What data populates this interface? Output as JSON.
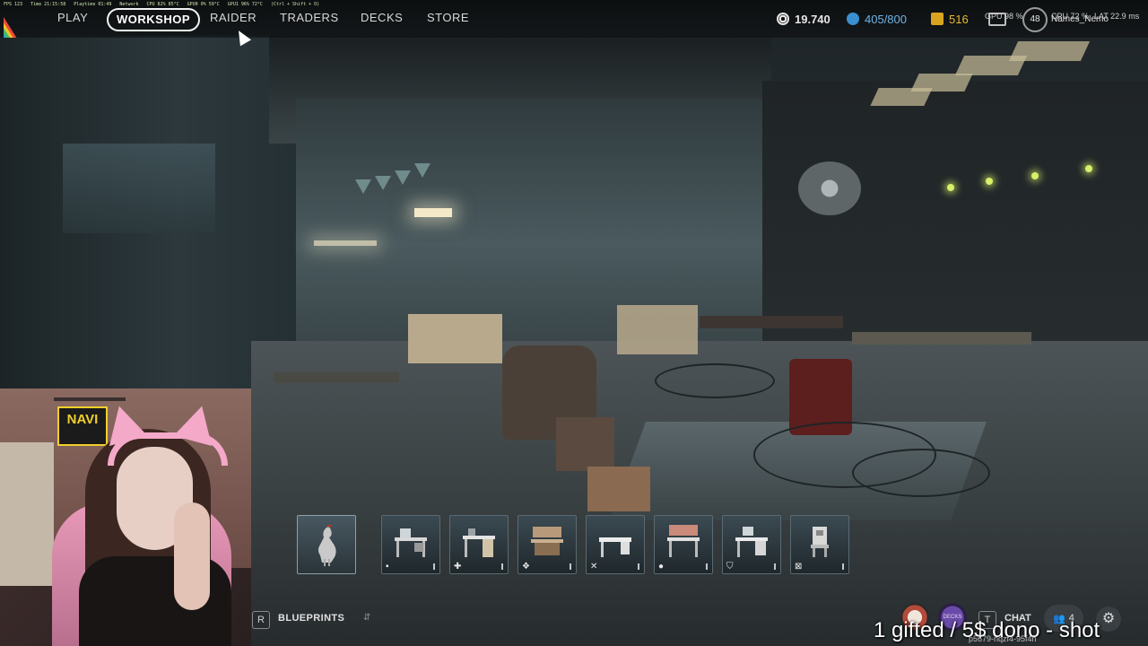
{
  "overlay_stats": [
    "FPS 123",
    "Time 21:15:58",
    "Playtime 01:49",
    "Network",
    "CPU 82% 85°C",
    "GPU0 0% 59°C",
    "GPU1 96% 72°C",
    "(Ctrl + Shift + O)"
  ],
  "nav": {
    "play": "PLAY",
    "workshop": "WORKSHOP",
    "raider": "RAIDER",
    "traders": "TRADERS",
    "decks": "DECKS",
    "store": "STORE"
  },
  "resources": {
    "coins": "19.740",
    "storage": "405/800",
    "tokens": "516",
    "gpu_label": "GPU 98 %",
    "level": "48",
    "cpu_label": "CPU 72 %",
    "username": "Names_Nemo",
    "lat_label": "LAT 22.9 ms"
  },
  "blueprints": {
    "key": "R",
    "label": "BLUEPRINTS",
    "slots": [
      {
        "name": "rooster",
        "icon": "rooster-icon",
        "symbol": ""
      },
      {
        "name": "workbench-1",
        "icon": "workbench-icon",
        "symbol": "▪"
      },
      {
        "name": "medical-station",
        "icon": "desk-icon",
        "symbol": "✚"
      },
      {
        "name": "refiner",
        "icon": "shelf-icon",
        "symbol": "❖"
      },
      {
        "name": "gunsmith",
        "icon": "table-icon",
        "symbol": "✕"
      },
      {
        "name": "utility-station",
        "icon": "bench-icon",
        "symbol": "●"
      },
      {
        "name": "gear-bench",
        "icon": "desk-icon",
        "symbol": "⛉"
      },
      {
        "name": "explosives-station",
        "icon": "machine-icon",
        "symbol": "⊠"
      }
    ]
  },
  "bottom_right": {
    "chat_key": "T",
    "chat_label": "CHAT",
    "friends_count": "4",
    "decks_badge": "DECKS"
  },
  "ticker": {
    "text": "1 gifted / 5$ dono - shot",
    "sub": "p5679-nqzf4-95f4h"
  },
  "colors": {
    "accent": "#f2f2f2",
    "storage_blue": "#3a8fd1",
    "token_gold": "#d9a520"
  }
}
